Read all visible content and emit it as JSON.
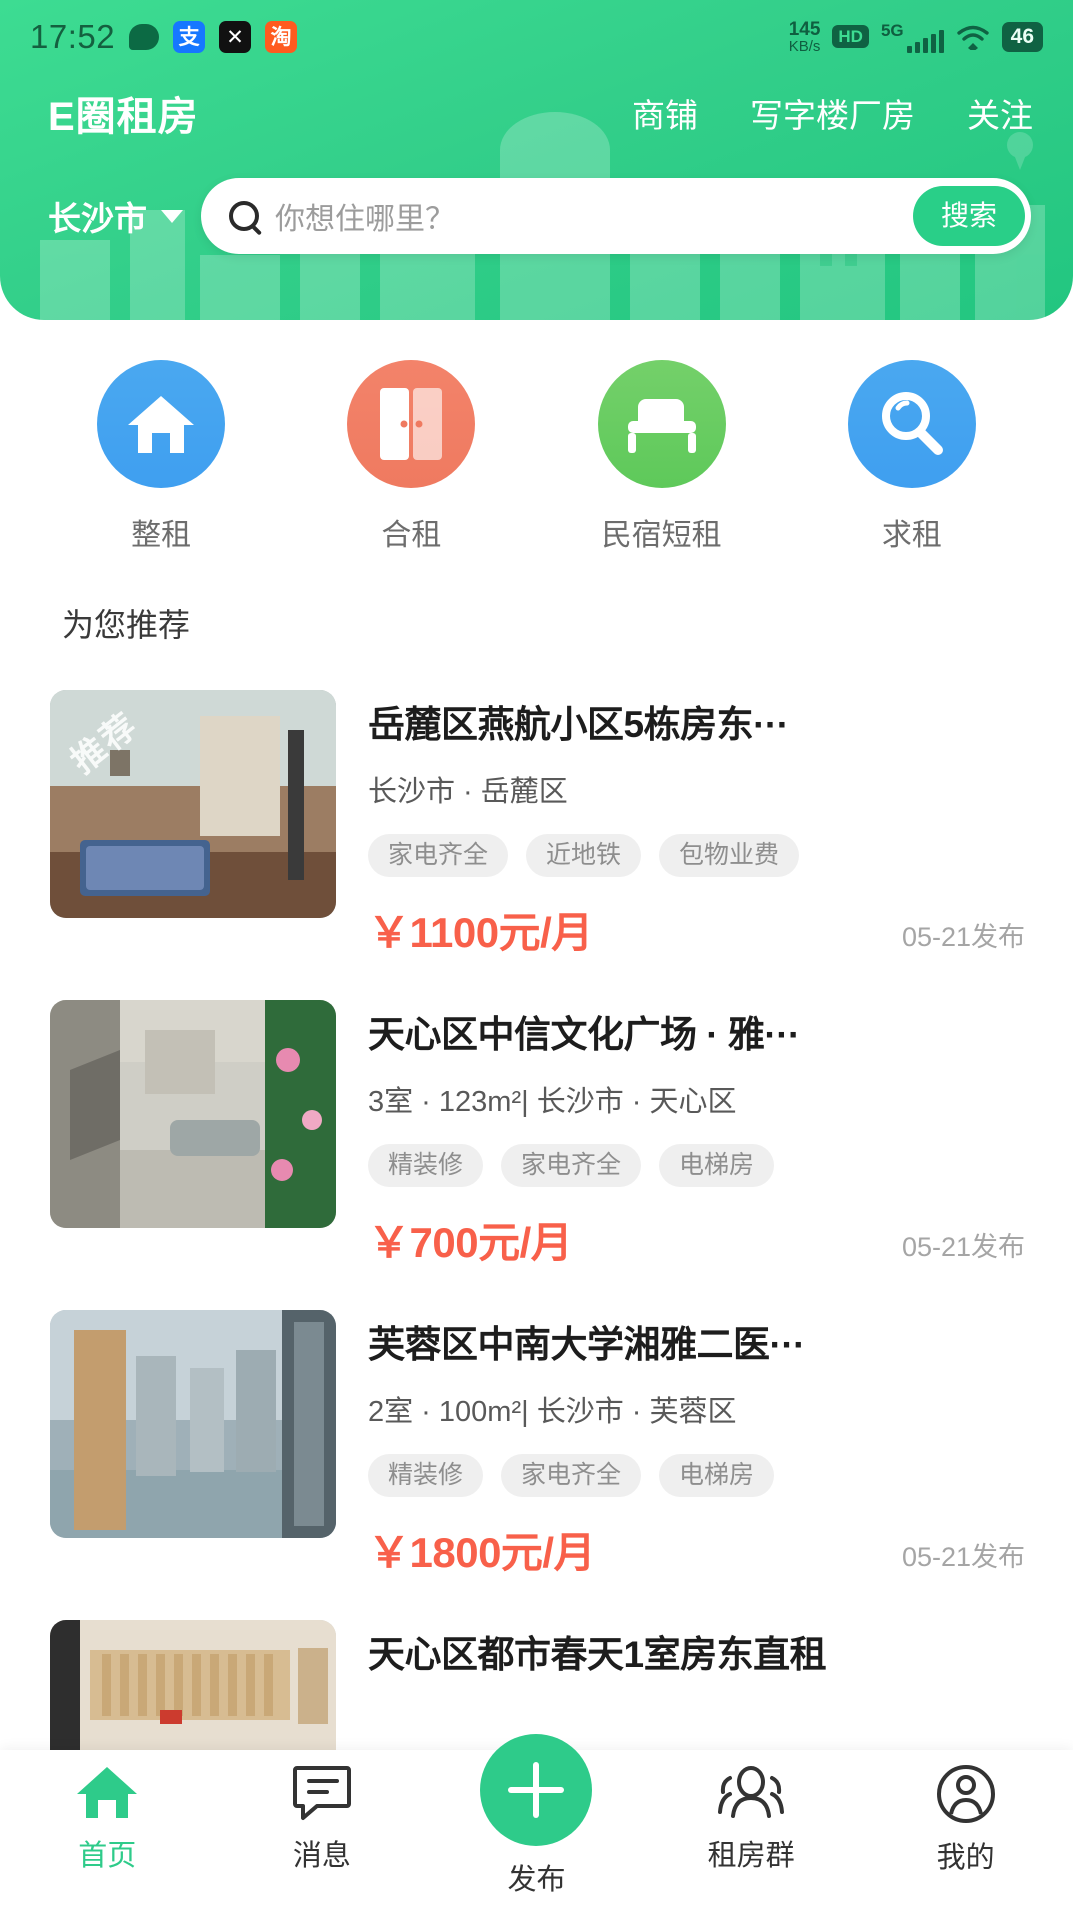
{
  "status_bar": {
    "time": "17:52",
    "icons": [
      "speech-bubble-icon",
      "alipay-icon",
      "x-app-icon",
      "taobao-icon"
    ],
    "alipay_glyph": "支",
    "x_glyph": "✕",
    "taobao_glyph": "淘",
    "network_speed": "145",
    "network_speed_unit": "KB/s",
    "hd_label": "HD",
    "network_type": "5G",
    "battery": "46"
  },
  "header": {
    "brand": "E圈租房",
    "nav": [
      {
        "label": "商铺"
      },
      {
        "label": "写字楼厂房"
      },
      {
        "label": "关注"
      }
    ],
    "city": "长沙市",
    "search_placeholder": "你想住哪里？",
    "search_button": "搜索",
    "accent_color": "#2ecb8a"
  },
  "categories": [
    {
      "label": "整租",
      "icon": "home-icon",
      "color": "#3f9ff0"
    },
    {
      "label": "合租",
      "icon": "wardrobe-doors-icon",
      "color": "#ef7a60"
    },
    {
      "label": "民宿短租",
      "icon": "bed-icon",
      "color": "#5ec95a"
    },
    {
      "label": "求租",
      "icon": "magnifier-icon",
      "color": "#3f9ff0"
    }
  ],
  "section": {
    "recommend_title": "为您推荐"
  },
  "listings": [
    {
      "title": "岳麓区燕航小区5栋房东···",
      "meta": "长沙市 · 岳麓区",
      "badge": "推荐",
      "tags": [
        "家电齐全",
        "近地铁",
        "包物业费"
      ],
      "price": "￥1100元/月",
      "published": "05-21发布"
    },
    {
      "title": "天心区中信文化广场 · 雅···",
      "meta": "3室 ·  123m²| 长沙市 · 天心区",
      "badge": "",
      "tags": [
        "精装修",
        "家电齐全",
        "电梯房"
      ],
      "price": "￥700元/月",
      "published": "05-21发布"
    },
    {
      "title": "芙蓉区中南大学湘雅二医···",
      "meta": "2室 ·  100m²| 长沙市 · 芙蓉区",
      "badge": "",
      "tags": [
        "精装修",
        "家电齐全",
        "电梯房"
      ],
      "price": "￥1800元/月",
      "published": "05-21发布"
    },
    {
      "title": "天心区都市春天1室房东直租",
      "meta": "",
      "badge": "",
      "tags": [],
      "price": "",
      "published": ""
    }
  ],
  "tabbar": [
    {
      "label": "首页",
      "icon": "home-icon",
      "active": true
    },
    {
      "label": "消息",
      "icon": "chat-icon",
      "active": false
    },
    {
      "label": "发布",
      "icon": "plus-icon",
      "active": false
    },
    {
      "label": "租房群",
      "icon": "people-group-icon",
      "active": false
    },
    {
      "label": "我的",
      "icon": "person-icon",
      "active": false
    }
  ],
  "price_color": "#f8604a"
}
